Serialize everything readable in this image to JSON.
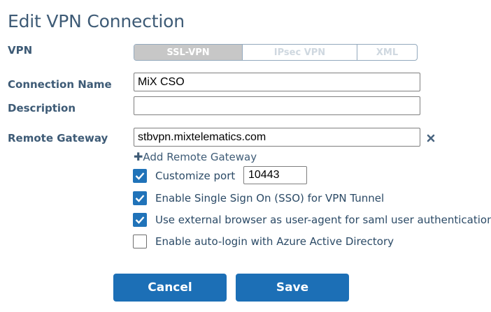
{
  "title": "Edit VPN Connection",
  "vpn": {
    "label": "VPN",
    "options": [
      "SSL-VPN",
      "IPsec VPN",
      "XML"
    ],
    "selected": "SSL-VPN"
  },
  "connection_name": {
    "label": "Connection Name",
    "value": "MiX CSO"
  },
  "description": {
    "label": "Description",
    "value": ""
  },
  "remote_gateway": {
    "label": "Remote Gateway",
    "value": "stbvpn.mixtelematics.com",
    "add_label": "Add Remote Gateway"
  },
  "options": {
    "customize_port": {
      "label": "Customize port",
      "checked": true,
      "port": "10443"
    },
    "sso": {
      "label": "Enable Single Sign On (SSO) for VPN Tunnel",
      "checked": true
    },
    "external_browser": {
      "label": "Use external browser as user-agent for saml user authentication",
      "checked": true
    },
    "azure_autologin": {
      "label": "Enable auto-login with Azure Active Directory",
      "checked": false
    }
  },
  "buttons": {
    "cancel": "Cancel",
    "save": "Save"
  },
  "colors": {
    "accent": "#1c6fb6",
    "text": "#3e5b76",
    "segment_active": "#c7c7c7"
  },
  "icons": {
    "remove": "close-icon",
    "add": "plus-icon",
    "check": "check-icon"
  }
}
